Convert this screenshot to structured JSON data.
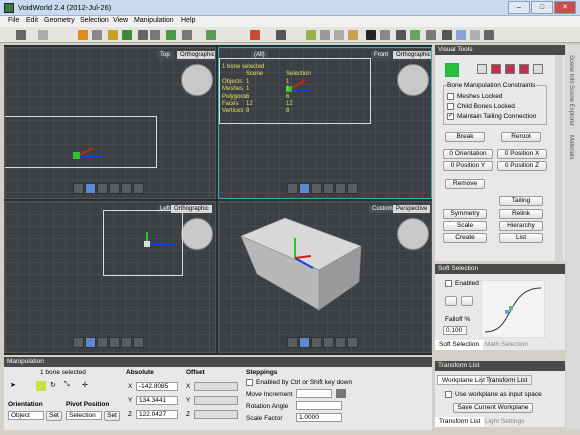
{
  "window": {
    "title": "VoidWorld 2.4 (2012-Jul-26)",
    "min": "–",
    "max": "□",
    "close": "✕"
  },
  "menu": [
    "File",
    "Edit",
    "Geometry",
    "Selection",
    "View",
    "Manipulation",
    "Help"
  ],
  "viewports": {
    "top": {
      "name": "Top",
      "mode": "Orthographic"
    },
    "all": {
      "name": "(All)"
    },
    "front": {
      "name": "Front",
      "mode": "Orthographic"
    },
    "left": {
      "name": "Left",
      "mode": "Orthographic"
    },
    "custom": {
      "name": "Custom",
      "mode": "Perspective"
    }
  },
  "stats": {
    "selected": "1 bone selected",
    "col_scene": "Scene",
    "col_selection": "Selection",
    "rows": [
      {
        "label": "Objects",
        "scene": "1",
        "sel": "1"
      },
      {
        "label": "Meshes",
        "scene": "1",
        "sel": "1"
      },
      {
        "label": "Polygons",
        "scene": "6",
        "sel": "6"
      },
      {
        "label": "Faces",
        "scene": "12",
        "sel": "12"
      },
      {
        "label": "Vertices",
        "scene": "8",
        "sel": "8"
      }
    ]
  },
  "visual_tools": {
    "title": "Visual Tools",
    "constraints_title": "Bone Manipulation Constraints",
    "meshes_locked": "Meshes Locked",
    "child_bones_locked": "Child Bones Locked",
    "maintain_tailing": "Maintain Tailing Connection",
    "break": "Break",
    "reroot": "Reroot",
    "orientation0": "0 Orientation",
    "posx0": "0 Position X",
    "posy0": "0 Position Y",
    "posz0": "0 Position Z",
    "remove": "Remove",
    "tailing": "Tailing",
    "symmetry": "Symmetry",
    "relink": "Relink",
    "scale": "Scale",
    "hierarchy": "Hierarchy",
    "create": "Create",
    "list": "List"
  },
  "soft_selection": {
    "title": "Soft Selection",
    "enabled": "Enabled",
    "falloff": "Falloff %",
    "falloff_value": "0.100",
    "tab1": "Soft Selection",
    "tab2": "Math Selection"
  },
  "transform_list": {
    "title": "Transform List",
    "tab1": "Workplane List",
    "tab2": "Transform List",
    "use_workplane": "Use workplane as input space",
    "save_workplane": "Save Current Workplane",
    "bottom_tab1": "Transform List",
    "bottom_tab2": "Light Settings"
  },
  "side_tabs": [
    "Scene Info",
    "Scene Explorer",
    "Materials"
  ],
  "manipulation": {
    "title": "Manipulation",
    "selected": "1 bone selected",
    "absolute": "Absolute",
    "offset": "Offset",
    "steppings": "Steppings",
    "x_label": "X",
    "y_label": "Y",
    "z_label": "Z",
    "x": "-142.8085",
    "y": "134.3441",
    "z": "122.0427",
    "enabled_by_ctrl": "Enabled by Ctrl or Shift key down",
    "move_increment": "Move Increment",
    "rotation_angle": "Rotation Angle",
    "scale_factor": "Scale Factor",
    "scale_value": "1.0000",
    "orientation": "Orientation",
    "orientation_value": "Object",
    "pivot_position": "Pivot Position",
    "pivot_value": "Selection",
    "set": "Set"
  }
}
